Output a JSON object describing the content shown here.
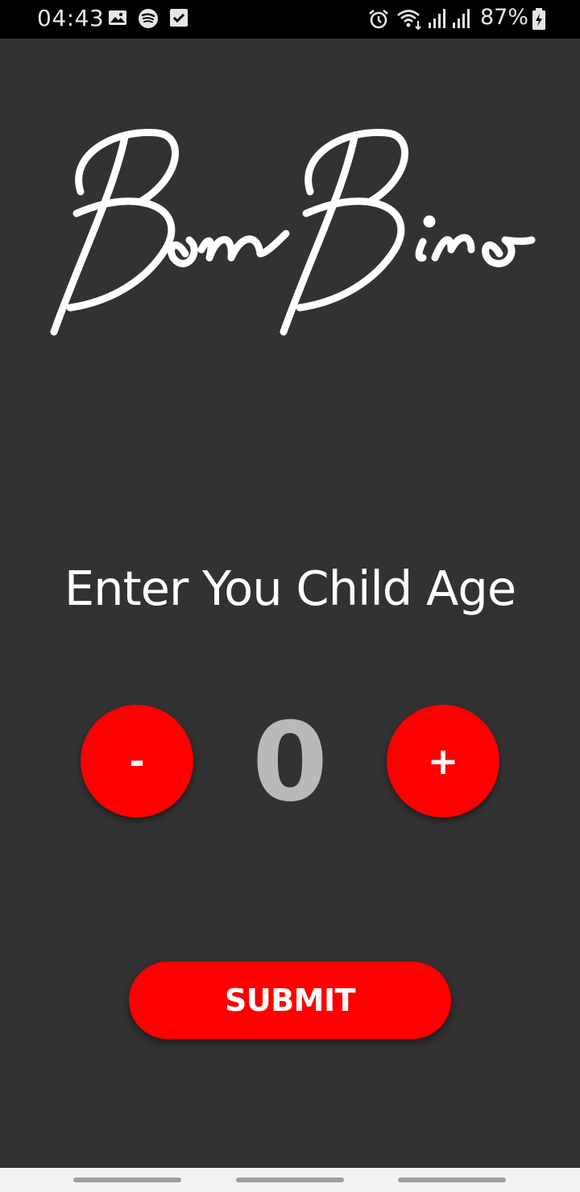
{
  "status_bar": {
    "time": "04:43",
    "battery": "87%",
    "left_icons": [
      "image-icon",
      "spotify-icon",
      "checkbox-icon"
    ],
    "right_icons": [
      "alarm-icon",
      "wifi-icon",
      "signal-icon",
      "signal-icon",
      "battery-charging-icon"
    ]
  },
  "logo": {
    "text": "BomBino"
  },
  "screen": {
    "headline": "Enter You Child Age",
    "stepper": {
      "decrement_label": "-",
      "increment_label": "+",
      "value": "0"
    },
    "submit_label": "SUBMIT"
  },
  "colors": {
    "background": "#323232",
    "accent": "#ff0000",
    "value_text": "#b9b9b9"
  }
}
